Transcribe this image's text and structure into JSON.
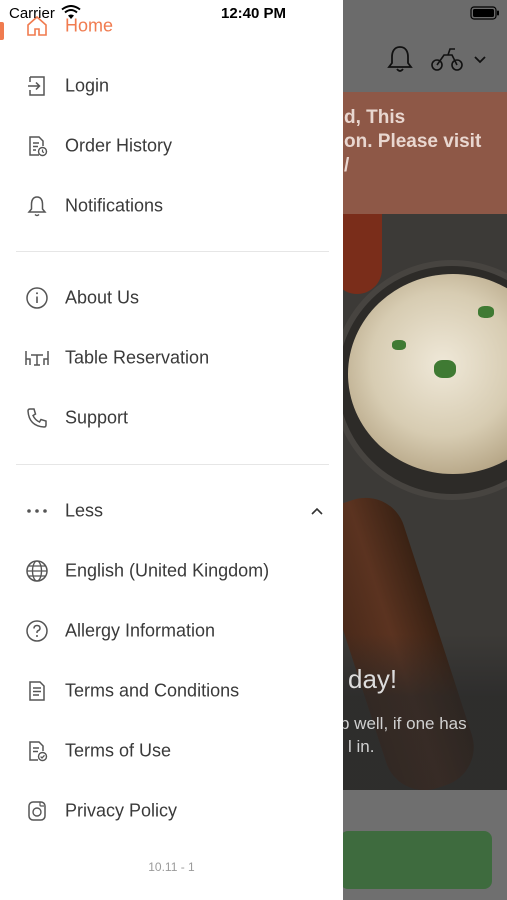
{
  "status_bar": {
    "carrier": "Carrier",
    "time": "12:40 PM"
  },
  "background": {
    "banner_lines": [
      "d, This",
      "on. Please visit",
      "/"
    ],
    "promo_title": "day!",
    "promo_text_lines": [
      "p well, if one has",
      "l in."
    ]
  },
  "drawer": {
    "items": [
      {
        "label": "Home",
        "icon": "home-icon"
      },
      {
        "label": "Login",
        "icon": "login-icon"
      },
      {
        "label": "Order History",
        "icon": "order-history-icon"
      },
      {
        "label": "Notifications",
        "icon": "bell-icon"
      },
      {
        "label": "About Us",
        "icon": "info-icon"
      },
      {
        "label": "Table Reservation",
        "icon": "table-icon"
      },
      {
        "label": "Support",
        "icon": "phone-icon"
      },
      {
        "label": "Less",
        "icon": "more-dots-icon"
      },
      {
        "label": "English (United Kingdom)",
        "icon": "globe-icon"
      },
      {
        "label": "Allergy Information",
        "icon": "question-icon"
      },
      {
        "label": "Terms and Conditions",
        "icon": "document-icon"
      },
      {
        "label": "Terms of Use",
        "icon": "document-check-icon"
      },
      {
        "label": "Privacy Policy",
        "icon": "privacy-icon"
      }
    ],
    "version": "10.11 - 1"
  },
  "colors": {
    "accent": "#f07b4f",
    "text": "#3a3a3a",
    "overlay": "#5f5f5f"
  }
}
